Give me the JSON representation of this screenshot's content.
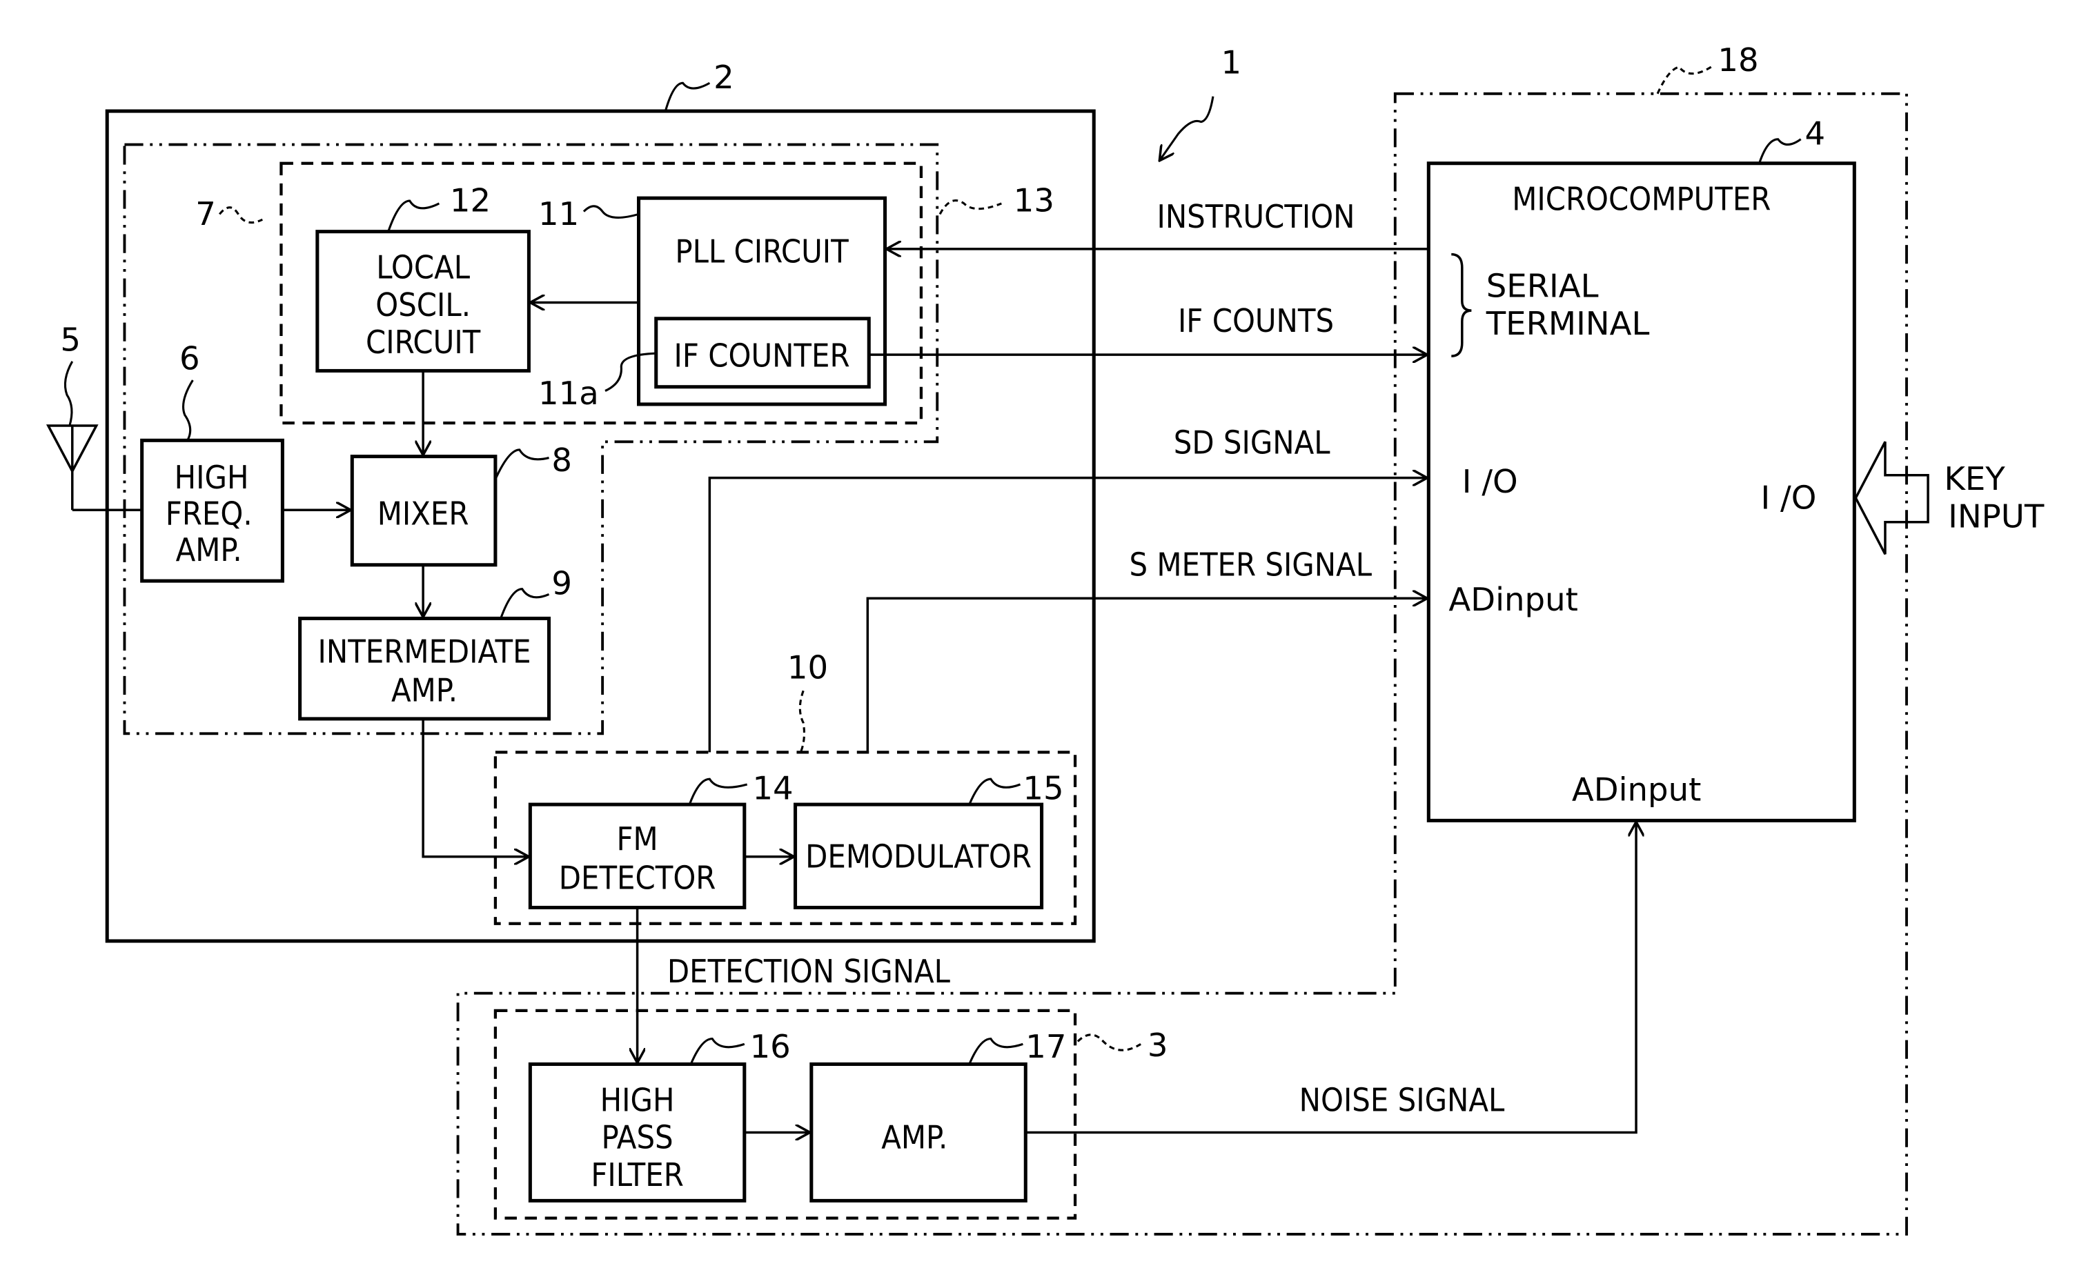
{
  "diagram": {
    "reference_numerals": {
      "system": "1",
      "tuner_unit": "2",
      "noise_detection_unit": "3",
      "microcomputer": "4",
      "antenna": "5",
      "high_freq_amp": "6",
      "frontend_group": "7",
      "mixer": "8",
      "intermediate_amp": "9",
      "detection_group": "10",
      "pll_circuit": "11",
      "if_counter": "11a",
      "local_oscillator": "12",
      "pll_group": "13",
      "fm_detector": "14",
      "demodulator": "15",
      "high_pass_filter": "16",
      "amp": "17",
      "control_unit": "18"
    },
    "blocks": {
      "local_oscillator": [
        "LOCAL",
        "OSCIL.",
        "CIRCUIT"
      ],
      "pll_circuit": "PLL CIRCUIT",
      "if_counter": "IF COUNTER",
      "high_freq_amp": [
        "HIGH",
        "FREQ.",
        "AMP."
      ],
      "mixer": "MIXER",
      "intermediate_amp": [
        "INTERMEDIATE",
        "AMP."
      ],
      "fm_detector": [
        "FM",
        "DETECTOR"
      ],
      "demodulator": "DEMODULATOR",
      "high_pass_filter": [
        "HIGH",
        "PASS",
        "FILTER"
      ],
      "amp": "AMP.",
      "microcomputer": "MICROCOMPUTER"
    },
    "microcomputer_ports": {
      "serial_terminal": [
        "SERIAL",
        "TERMINAL"
      ],
      "io_left": "I /O",
      "io_right": "I /O",
      "adinput_left": "ADinput",
      "adinput_bottom": "ADinput"
    },
    "signals": {
      "instruction": "INSTRUCTION",
      "if_counts": "IF COUNTS",
      "sd_signal": "SD SIGNAL",
      "s_meter_signal": "S METER SIGNAL",
      "detection_signal": "DETECTION SIGNAL",
      "noise_signal": "NOISE SIGNAL",
      "key_input": [
        "KEY",
        "INPUT"
      ]
    }
  }
}
